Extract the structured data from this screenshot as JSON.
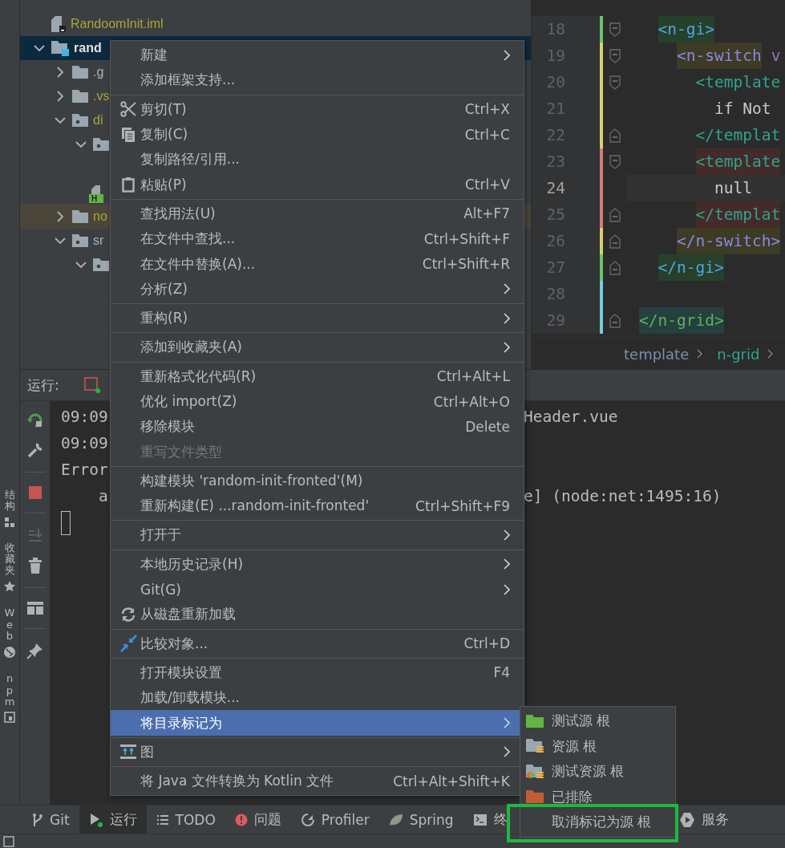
{
  "project_tree": {
    "items": [
      {
        "name": "RandoomInit.iml",
        "kind": "iml-file",
        "color": "#a6a639",
        "selected": false,
        "excluded": false
      },
      {
        "name": "rand",
        "kind": "module",
        "color": "#dfe1e5",
        "expanded": true,
        "selected": true,
        "excluded": false,
        "children": [
          {
            "name": ".g",
            "kind": "folder",
            "color": "#afb1b3",
            "expanded": false,
            "selected": false,
            "excluded": false
          },
          {
            "name": ".vs",
            "kind": "folder",
            "color": "#a6a639",
            "expanded": false,
            "selected": false,
            "excluded": false
          },
          {
            "name": "di",
            "kind": "package",
            "color": "#a6a639",
            "expanded": true,
            "selected": false,
            "excluded": false,
            "children": [
              {
                "kind": "package",
                "expanded": true,
                "selected": false,
                "excluded": false,
                "children": [
                  {
                    "kind": "html-file",
                    "badge": "H",
                    "selected": false,
                    "excluded": false
                  }
                ]
              }
            ]
          },
          {
            "name": "no",
            "kind": "folder",
            "color": "#a6a639",
            "expanded": false,
            "selected": false,
            "excluded": true
          },
          {
            "name": "sr",
            "kind": "package",
            "color": "#afb1b3",
            "expanded": true,
            "selected": false,
            "excluded": false,
            "children": [
              {
                "kind": "package",
                "expanded": true,
                "selected": false,
                "excluded": false
              }
            ]
          }
        ]
      }
    ]
  },
  "editor": {
    "lines": [
      {
        "number": "18",
        "color": "#6ac36a",
        "kind": "open",
        "current": false,
        "segments": [
          {
            "text": "<n-gi>",
            "kind": "tag-gi"
          }
        ]
      },
      {
        "number": "19",
        "color": "#d6d26a",
        "kind": "open",
        "current": false,
        "segments": [
          {
            "text": "<n-switch",
            "kind": "tag-switch"
          },
          {
            "text": "v",
            "kind": "attr"
          }
        ]
      },
      {
        "number": "20",
        "color": "#d6d26a",
        "kind": "open",
        "current": false,
        "segments": [
          {
            "text": "<template",
            "kind": "tag-template"
          }
        ]
      },
      {
        "number": "21",
        "color": "#d6d26a",
        "kind": "text",
        "current": false,
        "segments": [
          {
            "text": "if Not",
            "kind": "text"
          }
        ]
      },
      {
        "number": "22",
        "color": "#d6d26a",
        "kind": "close",
        "current": false,
        "segments": [
          {
            "text": "</templat",
            "kind": "tag-template"
          }
        ]
      },
      {
        "number": "23",
        "color": "#d97a7a",
        "kind": "open",
        "current": false,
        "segments": [
          {
            "text": "<template",
            "kind": "tag-template-alt"
          }
        ]
      },
      {
        "number": "24",
        "color": "#d97a7a",
        "kind": "text",
        "current": true,
        "segments": [
          {
            "text": "null",
            "kind": "text"
          }
        ]
      },
      {
        "number": "25",
        "color": "#d97a7a",
        "kind": "close",
        "current": false,
        "segments": [
          {
            "text": "</templat",
            "kind": "tag-template-alt"
          }
        ]
      },
      {
        "number": "26",
        "color": "#d6d26a",
        "kind": "close",
        "current": false,
        "segments": [
          {
            "text": "</n-switch>",
            "kind": "tag-switch"
          }
        ]
      },
      {
        "number": "27",
        "color": "#6ac36a",
        "kind": "close",
        "current": false,
        "segments": [
          {
            "text": "</n-gi>",
            "kind": "tag-gi"
          }
        ]
      },
      {
        "number": "28",
        "color": "#6fd0d8",
        "kind": "text",
        "current": false
      },
      {
        "number": "29",
        "color": "#6fd0d8",
        "kind": "close",
        "current": false,
        "segments": [
          {
            "text": "</n-grid>",
            "kind": "tag-grid"
          }
        ]
      }
    ],
    "breadcrumbs": [
      "template",
      "n-grid"
    ]
  },
  "run_panel": {
    "title": "运行:",
    "console": [
      {
        "left": "09:09",
        "right": "Header.vue"
      },
      {
        "left": "09:09"
      },
      {
        "left": "Error"
      },
      {
        "left": "a",
        "kind": "indented",
        "right": "e] (node:net:1495:16)"
      }
    ]
  },
  "left_strip": [
    {
      "label": "结构",
      "kind": "structure"
    },
    {
      "label": "收藏夹",
      "kind": "favorites"
    },
    {
      "label": "Web",
      "kind": "web"
    },
    {
      "label": "npm",
      "kind": "npm"
    }
  ],
  "context_menu": {
    "groups": [
      [
        {
          "label": "新建",
          "kind": "plain",
          "submenu": true,
          "disabled": false,
          "selected": false
        },
        {
          "label": "添加框架支持...",
          "kind": "plain",
          "submenu": false,
          "disabled": false,
          "selected": false
        }
      ],
      [
        {
          "label": "剪切(T)",
          "kind": "cut",
          "shortcut": "Ctrl+X",
          "submenu": false,
          "disabled": false,
          "selected": false
        },
        {
          "label": "复制(C)",
          "kind": "copy",
          "shortcut": "Ctrl+C",
          "submenu": false,
          "disabled": false,
          "selected": false
        },
        {
          "label": "复制路径/引用...",
          "kind": "plain",
          "submenu": false,
          "disabled": false,
          "selected": false
        },
        {
          "label": "粘贴(P)",
          "kind": "paste",
          "shortcut": "Ctrl+V",
          "submenu": false,
          "disabled": false,
          "selected": false
        }
      ],
      [
        {
          "label": "查找用法(U)",
          "kind": "plain",
          "shortcut": "Alt+F7",
          "submenu": false,
          "disabled": false,
          "selected": false
        },
        {
          "label": "在文件中查找...",
          "kind": "plain",
          "shortcut": "Ctrl+Shift+F",
          "submenu": false,
          "disabled": false,
          "selected": false
        },
        {
          "label": "在文件中替换(A)...",
          "kind": "plain",
          "shortcut": "Ctrl+Shift+R",
          "submenu": false,
          "disabled": false,
          "selected": false
        },
        {
          "label": "分析(Z)",
          "kind": "plain",
          "submenu": true,
          "disabled": false,
          "selected": false
        }
      ],
      [
        {
          "label": "重构(R)",
          "kind": "plain",
          "submenu": true,
          "disabled": false,
          "selected": false
        }
      ],
      [
        {
          "label": "添加到收藏夹(A)",
          "kind": "plain",
          "submenu": true,
          "disabled": false,
          "selected": false
        }
      ],
      [
        {
          "label": "重新格式化代码(R)",
          "kind": "plain",
          "shortcut": "Ctrl+Alt+L",
          "submenu": false,
          "disabled": false,
          "selected": false
        },
        {
          "label": "优化 import(Z)",
          "kind": "plain",
          "shortcut": "Ctrl+Alt+O",
          "submenu": false,
          "disabled": false,
          "selected": false
        },
        {
          "label": "移除模块",
          "kind": "plain",
          "shortcut": "Delete",
          "submenu": false,
          "disabled": false,
          "selected": false
        },
        {
          "label": "重写文件类型",
          "kind": "plain",
          "submenu": false,
          "disabled": true,
          "selected": false
        }
      ],
      [
        {
          "label": "构建模块 'random-init-fronted'(M)",
          "kind": "plain",
          "submenu": false,
          "disabled": false,
          "selected": false
        },
        {
          "label": "重新构建(E) ...random-init-fronted'",
          "kind": "plain",
          "shortcut": "Ctrl+Shift+F9",
          "submenu": false,
          "disabled": false,
          "selected": false
        }
      ],
      [
        {
          "label": "打开于",
          "kind": "plain",
          "submenu": true,
          "disabled": false,
          "selected": false
        }
      ],
      [
        {
          "label": "本地历史记录(H)",
          "kind": "plain",
          "submenu": true,
          "disabled": false,
          "selected": false
        },
        {
          "label": "Git(G)",
          "kind": "plain",
          "submenu": true,
          "disabled": false,
          "selected": false
        },
        {
          "label": "从磁盘重新加载",
          "kind": "reload",
          "submenu": false,
          "disabled": false,
          "selected": false
        }
      ],
      [
        {
          "label": "比较对象...",
          "kind": "compare",
          "shortcut": "Ctrl+D",
          "submenu": false,
          "disabled": false,
          "selected": false
        }
      ],
      [
        {
          "label": "打开模块设置",
          "kind": "plain",
          "shortcut": "F4",
          "submenu": false,
          "disabled": false,
          "selected": false
        },
        {
          "label": "加载/卸载模块...",
          "kind": "plain",
          "submenu": false,
          "disabled": false,
          "selected": false
        },
        {
          "label": "将目录标记为",
          "kind": "plain",
          "submenu": true,
          "disabled": false,
          "selected": true
        }
      ],
      [
        {
          "label": "图",
          "kind": "diagram",
          "submenu": true,
          "disabled": false,
          "selected": false
        }
      ],
      [
        {
          "label": "将 Java 文件转换为 Kotlin 文件",
          "kind": "plain",
          "shortcut": "Ctrl+Alt+Shift+K",
          "submenu": false,
          "disabled": false,
          "selected": false
        }
      ]
    ]
  },
  "submenu": {
    "items": [
      {
        "label": "测试源 根",
        "kind": "test-sources"
      },
      {
        "label": "资源 根",
        "kind": "resources"
      },
      {
        "label": "测试资源 根",
        "kind": "test-resources"
      },
      {
        "label": "已排除",
        "kind": "excluded"
      },
      {
        "label": "取消标记为源 根",
        "kind": "plain"
      }
    ]
  },
  "tool_tabs": [
    {
      "label": "Git",
      "kind": "git",
      "selected": false
    },
    {
      "label": "运行",
      "kind": "run",
      "selected": true
    },
    {
      "label": "TODO",
      "kind": "todo",
      "selected": false
    },
    {
      "label": "问题",
      "kind": "problems",
      "selected": false
    },
    {
      "label": "Profiler",
      "kind": "profiler",
      "selected": false
    },
    {
      "label": "Spring",
      "kind": "spring",
      "selected": false
    },
    {
      "label": "终",
      "kind": "terminal",
      "selected": false
    },
    {
      "label": "服务",
      "kind": "services",
      "selected": false
    }
  ]
}
